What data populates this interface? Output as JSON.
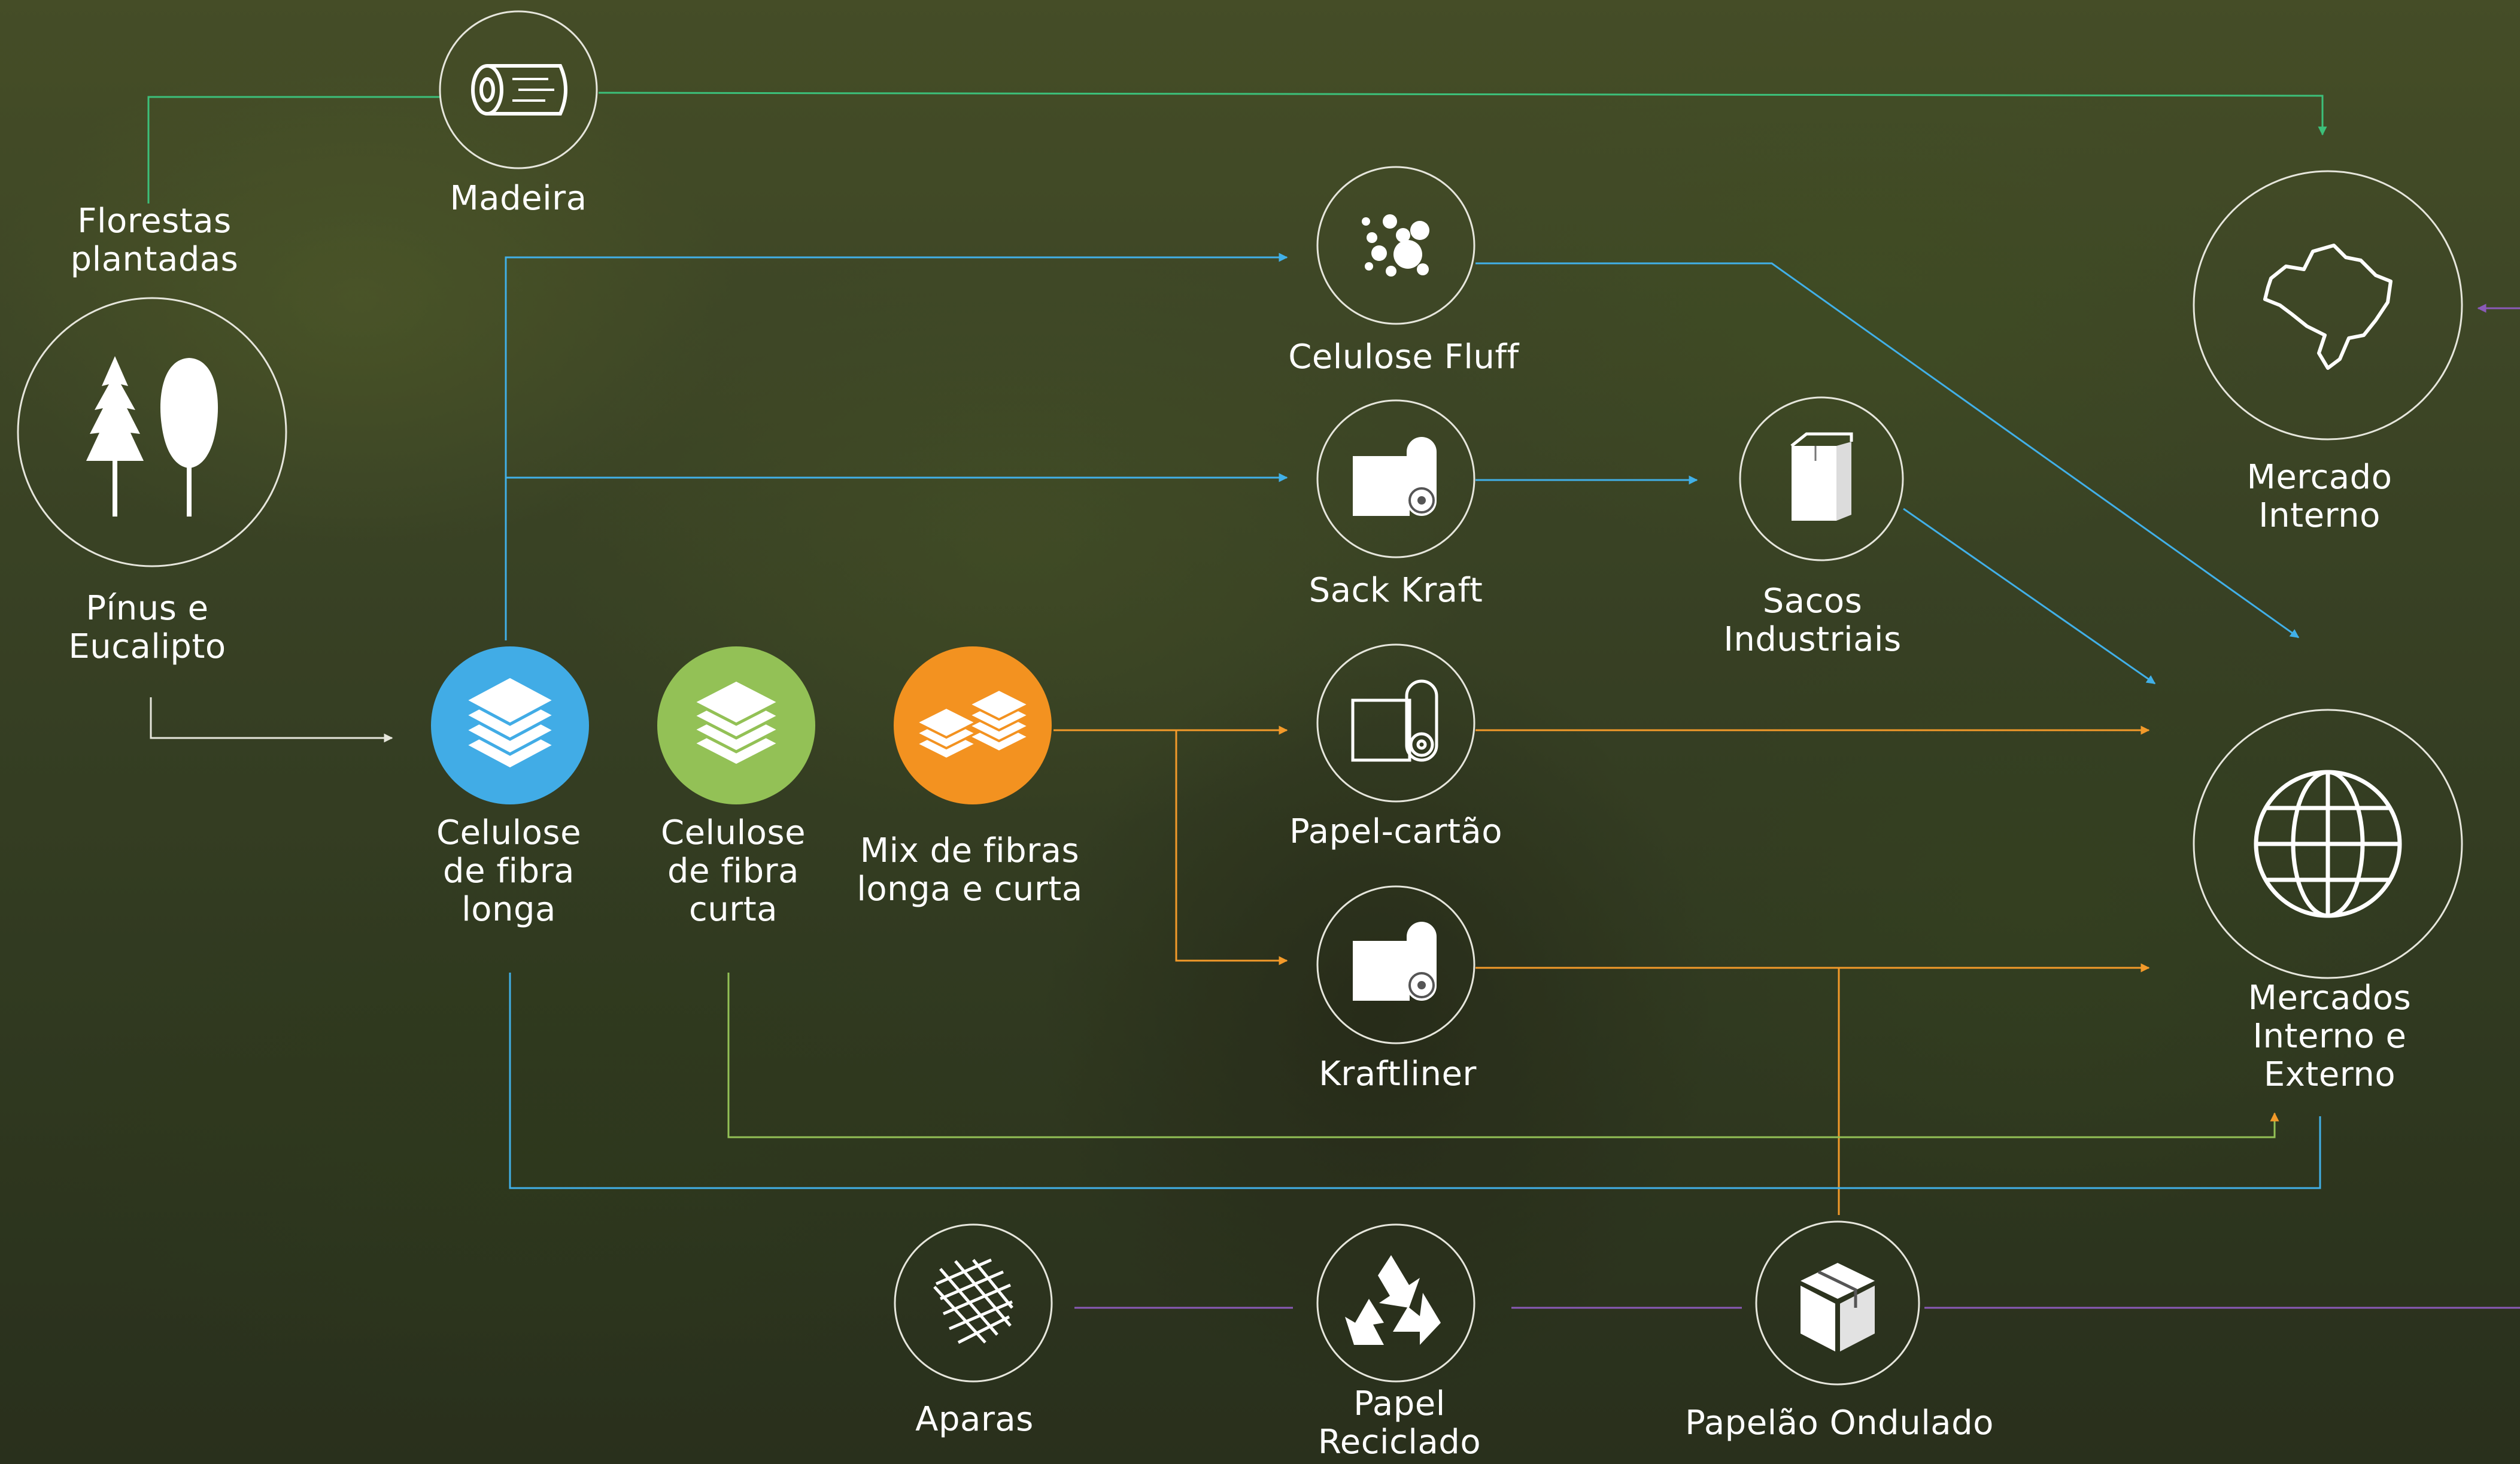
{
  "colors": {
    "blue": "#41ace6",
    "green": "#93c156",
    "orange": "#f39220",
    "ring": "#e6e6dc",
    "line_green": "#3cc07a",
    "line_blue": "#41b0e8",
    "line_orange": "#f39a2a",
    "line_purple": "#8a5ab8"
  },
  "nodes": {
    "madeira": {
      "label": "Madeira",
      "icon": "log-icon"
    },
    "florestas": {
      "label": "Florestas\nplantadas"
    },
    "pinus": {
      "label": "Pínus e\nEucalipto",
      "icon": "trees-icon"
    },
    "fibra_longa": {
      "label": "Celulose\nde fibra\nlonga",
      "icon": "layers-icon"
    },
    "fibra_curta": {
      "label": "Celulose\nde fibra\ncurta",
      "icon": "layers-icon"
    },
    "mix": {
      "label": "Mix de fibras\nlonga e curta",
      "icon": "double-layers-icon"
    },
    "fluff": {
      "label": "Celulose Fluff",
      "icon": "bubbles-icon"
    },
    "sack_kraft": {
      "label": "Sack Kraft",
      "icon": "paper-roll-icon"
    },
    "sacos": {
      "label": "Sacos\nIndustriais",
      "icon": "paper-bag-icon"
    },
    "papel_cartao": {
      "label": "Papel-cartão",
      "icon": "paper-roll-outline-icon"
    },
    "kraftliner": {
      "label": "Kraftliner",
      "icon": "paper-roll-icon"
    },
    "mercado_interno": {
      "label": "Mercado\nInterno",
      "icon": "brazil-map-icon"
    },
    "mercados": {
      "label": "Mercados\nInterno e\nExterno",
      "icon": "globe-icon"
    },
    "aparas": {
      "label": "Aparas",
      "icon": "shreds-icon"
    },
    "papel_reciclado": {
      "label": "Papel\nReciclado",
      "icon": "recycle-icon"
    },
    "papelao": {
      "label": "Papelão Ondulado",
      "icon": "box-icon"
    }
  }
}
